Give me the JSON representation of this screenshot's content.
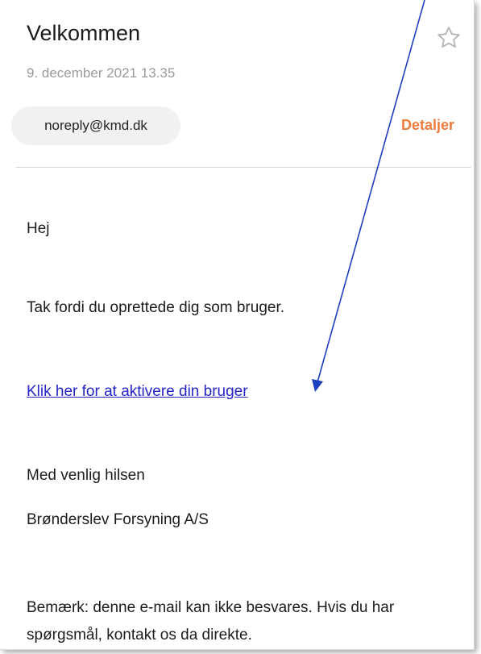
{
  "email": {
    "subject": "Velkommen",
    "date": "9. december 2021  13.35",
    "sender": "noreply@kmd.dk",
    "details_label": "Detaljer",
    "star_icon": "star-outline-icon"
  },
  "body": {
    "greeting": "Hej",
    "thanks": "Tak fordi du oprettede dig som bruger.",
    "activate_link": "Klik her for at aktivere din bruger",
    "regards": "Med venlig hilsen",
    "company": "Brønderslev Forsyning A/S",
    "note_line1": "Bemærk: denne e-mail kan ikke besvares. Hvis du har",
    "note_line2": "spørgsmål, kontakt os da direkte."
  },
  "colors": {
    "accent": "#ef7c3f",
    "link": "#2424c8",
    "annotation_arrow": "#1e3fbf"
  }
}
